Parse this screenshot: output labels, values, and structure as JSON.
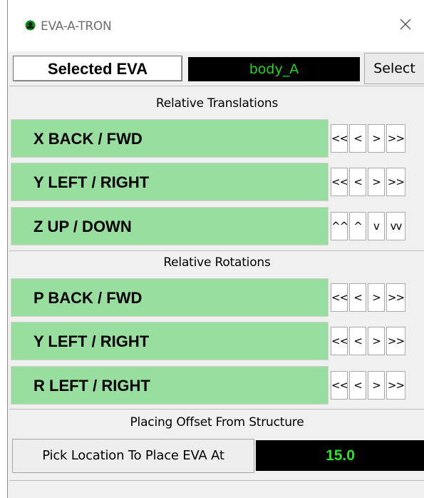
{
  "window": {
    "title": "EVA-A-TRON",
    "icon": "green-dot-app-icon",
    "close_icon": "close-icon"
  },
  "selection": {
    "label": "Selected EVA",
    "value": "body_A",
    "button_label": "Select"
  },
  "translations": {
    "heading": "Relative Translations",
    "rows": [
      {
        "label": "X BACK / FWD",
        "buttons": [
          "<<",
          "<",
          ">",
          ">>"
        ]
      },
      {
        "label": "Y LEFT / RIGHT",
        "buttons": [
          "<<",
          "<",
          ">",
          ">>"
        ]
      },
      {
        "label": "Z UP / DOWN",
        "buttons": [
          "^^",
          "^",
          "v",
          "vv"
        ]
      }
    ]
  },
  "rotations": {
    "heading": "Relative Rotations",
    "rows": [
      {
        "label": "P BACK / FWD",
        "buttons": [
          "<<",
          "<",
          ">",
          ">>"
        ]
      },
      {
        "label": "Y LEFT / RIGHT",
        "buttons": [
          "<<",
          "<",
          ">",
          ">>"
        ]
      },
      {
        "label": "R LEFT / RIGHT",
        "buttons": [
          "<<",
          "<",
          ">",
          ">>"
        ]
      }
    ]
  },
  "placement": {
    "heading": "Placing Offset From Structure",
    "button_label": "Pick Location To Place EVA At",
    "offset_value": "15.0"
  },
  "colors": {
    "row_green": "#98de9e",
    "readout_background": "#000000",
    "readout_text": "#1fd71f"
  }
}
